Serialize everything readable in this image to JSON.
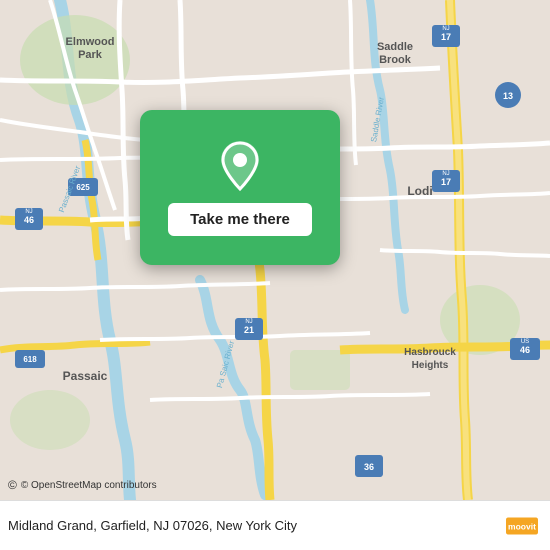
{
  "map": {
    "background_color": "#e8e0d8",
    "road_color_main": "#ffffff",
    "road_color_yellow": "#f5d547",
    "road_color_orange": "#f0a500"
  },
  "card": {
    "background": "#3cb563",
    "button_label": "Take me there"
  },
  "bottom_bar": {
    "address": "Midland Grand, Garfield, NJ 07026, New York City",
    "osm_credit": "© OpenStreetMap contributors",
    "moovit_label": "moovit"
  },
  "labels": {
    "elmwood_park": "Elmwood Park",
    "saddle_brook": "Saddle Brook",
    "lodi": "Lodi",
    "passaic": "Passaic",
    "hasbrouck_heights": "Hasbrouck Heights",
    "nj17": "NJ 17",
    "nj21": "NJ 21",
    "nj46": "NJ 46",
    "us46": "US 46",
    "r625": "625",
    "r618": "618",
    "r13": "13",
    "r36": "36"
  }
}
